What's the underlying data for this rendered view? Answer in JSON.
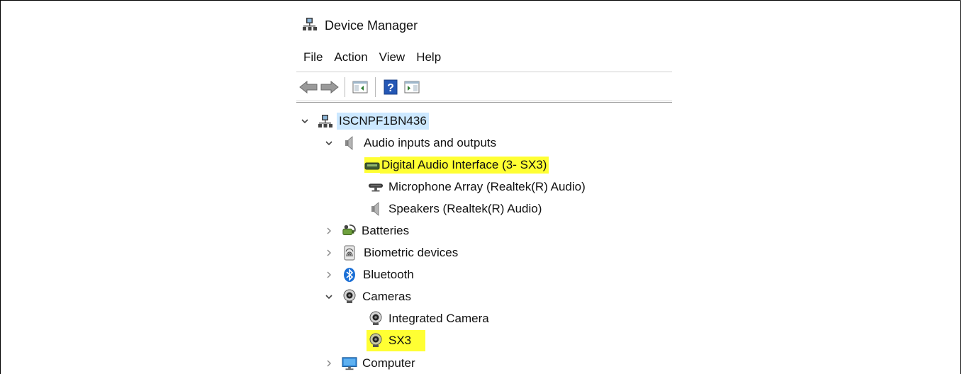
{
  "window": {
    "title": "Device Manager"
  },
  "menu": [
    "File",
    "Action",
    "View",
    "Help"
  ],
  "toolbar": {
    "buttons": [
      {
        "name": "back-button",
        "icon": "back-arrow-icon"
      },
      {
        "name": "forward-button",
        "icon": "forward-arrow-icon"
      },
      {
        "name": "show-hide-console-tree-button",
        "icon": "console-tree-icon"
      },
      {
        "name": "help-button",
        "icon": "help-icon"
      },
      {
        "name": "show-hide-action-pane-button",
        "icon": "action-pane-icon"
      }
    ]
  },
  "tree": {
    "root": {
      "label": "ISCNPF1BN436",
      "icon": "computer-network-icon",
      "expanded": true,
      "selected": true
    },
    "items": [
      {
        "label": "Audio inputs and outputs",
        "icon": "speaker-icon",
        "expanded": true,
        "depth": 1,
        "children": [
          {
            "label": "Digital Audio Interface (3- SX3)",
            "icon": "audio-interface-icon",
            "highlighted": true
          },
          {
            "label": "Microphone Array (Realtek(R) Audio)",
            "icon": "microphone-icon"
          },
          {
            "label": "Speakers (Realtek(R) Audio)",
            "icon": "speaker-icon"
          }
        ]
      },
      {
        "label": "Batteries",
        "icon": "battery-icon",
        "expanded": false,
        "depth": 1
      },
      {
        "label": "Biometric devices",
        "icon": "fingerprint-icon",
        "expanded": false,
        "depth": 1
      },
      {
        "label": "Bluetooth",
        "icon": "bluetooth-icon",
        "expanded": false,
        "depth": 1
      },
      {
        "label": "Cameras",
        "icon": "webcam-icon",
        "expanded": true,
        "depth": 1,
        "children": [
          {
            "label": "Integrated Camera",
            "icon": "webcam-icon"
          },
          {
            "label": "SX3",
            "icon": "webcam-icon",
            "highlighted": true
          }
        ]
      },
      {
        "label": "Computer",
        "icon": "monitor-icon",
        "expanded": false,
        "depth": 1
      }
    ]
  },
  "colors": {
    "highlight": "#ffff33",
    "selection": "#cce8ff"
  }
}
